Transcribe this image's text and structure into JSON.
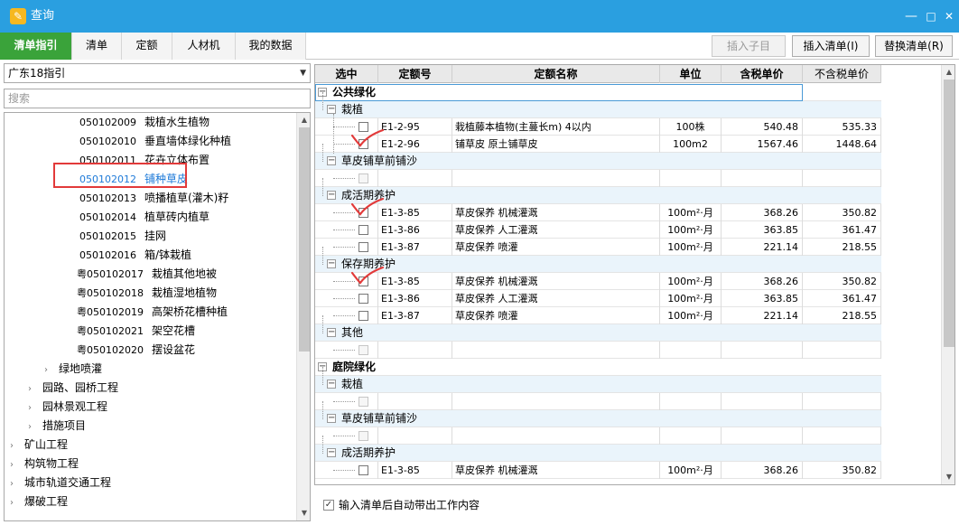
{
  "window": {
    "title": "查询",
    "minimize": "—",
    "maximize": "□",
    "close": "✕"
  },
  "tabs": [
    {
      "label": "清单指引",
      "active": true
    },
    {
      "label": "清单",
      "active": false
    },
    {
      "label": "定额",
      "active": false
    },
    {
      "label": "人材机",
      "active": false
    },
    {
      "label": "我的数据",
      "active": false
    }
  ],
  "toolbar": {
    "insert_child": "插入子目",
    "insert_list": "插入清单(I)",
    "replace_list": "替换清单(R)"
  },
  "left": {
    "combo_value": "广东18指引",
    "search_placeholder": "搜索",
    "tree": [
      {
        "code": "050102009",
        "name": "栽植水生植物"
      },
      {
        "code": "050102010",
        "name": "垂直墙体绿化种植"
      },
      {
        "code": "050102011",
        "name": "花卉立体布置"
      },
      {
        "code": "050102012",
        "name": "铺种草皮",
        "selected": true
      },
      {
        "code": "050102013",
        "name": "喷播植草(灌木)籽"
      },
      {
        "code": "050102014",
        "name": "植草砖内植草"
      },
      {
        "code": "050102015",
        "name": "挂网"
      },
      {
        "code": "050102016",
        "name": "箱/钵栽植"
      },
      {
        "code": "粤050102017",
        "name": "栽植其他地被"
      },
      {
        "code": "粤050102018",
        "name": "栽植湿地植物"
      },
      {
        "code": "粤050102019",
        "name": "高架桥花槽种植"
      },
      {
        "code": "粤050102021",
        "name": "架空花槽"
      },
      {
        "code": "粤050102020",
        "name": "摆设盆花"
      }
    ],
    "folders": [
      {
        "name": "绿地喷灌"
      },
      {
        "name": "园路、园桥工程"
      },
      {
        "name": "园林景观工程"
      },
      {
        "name": "措施项目"
      },
      {
        "name": "矿山工程"
      },
      {
        "name": "构筑物工程"
      },
      {
        "name": "城市轨道交通工程"
      },
      {
        "name": "爆破工程"
      }
    ]
  },
  "grid": {
    "headers": [
      "选中",
      "定额号",
      "定额名称",
      "单位",
      "含税单价",
      "不含税单价"
    ],
    "rows": [
      {
        "kind": "sec",
        "label": "公共绿化"
      },
      {
        "kind": "grp",
        "label": "栽植"
      },
      {
        "kind": "item",
        "code": "E1-2-95",
        "name": "栽植藤本植物(主蔓长m) 4以内",
        "unit": "100株",
        "price_tax": "540.48",
        "price": "535.33"
      },
      {
        "kind": "item",
        "code": "E1-2-96",
        "name": "铺草皮 原土铺草皮",
        "unit": "100m2",
        "price_tax": "1567.46",
        "price": "1448.64",
        "checked": true
      },
      {
        "kind": "grp",
        "label": "草皮铺草前铺沙"
      },
      {
        "kind": "empty"
      },
      {
        "kind": "grp",
        "label": "成活期养护"
      },
      {
        "kind": "item",
        "code": "E1-3-85",
        "name": "草皮保养 机械灌溉",
        "unit": "100m²·月",
        "price_tax": "368.26",
        "price": "350.82",
        "checked": true
      },
      {
        "kind": "item",
        "code": "E1-3-86",
        "name": "草皮保养 人工灌溉",
        "unit": "100m²·月",
        "price_tax": "363.85",
        "price": "361.47"
      },
      {
        "kind": "item",
        "code": "E1-3-87",
        "name": "草皮保养 喷灌",
        "unit": "100m²·月",
        "price_tax": "221.14",
        "price": "218.55"
      },
      {
        "kind": "grp",
        "label": "保存期养护"
      },
      {
        "kind": "item",
        "code": "E1-3-85",
        "name": "草皮保养 机械灌溉",
        "unit": "100m²·月",
        "price_tax": "368.26",
        "price": "350.82",
        "checked": true
      },
      {
        "kind": "item",
        "code": "E1-3-86",
        "name": "草皮保养 人工灌溉",
        "unit": "100m²·月",
        "price_tax": "363.85",
        "price": "361.47"
      },
      {
        "kind": "item",
        "code": "E1-3-87",
        "name": "草皮保养 喷灌",
        "unit": "100m²·月",
        "price_tax": "221.14",
        "price": "218.55"
      },
      {
        "kind": "grp",
        "label": "其他"
      },
      {
        "kind": "empty"
      },
      {
        "kind": "sec",
        "label": "庭院绿化"
      },
      {
        "kind": "grp",
        "label": "栽植"
      },
      {
        "kind": "empty"
      },
      {
        "kind": "grp",
        "label": "草皮铺草前铺沙"
      },
      {
        "kind": "empty"
      },
      {
        "kind": "grp",
        "label": "成活期养护"
      },
      {
        "kind": "item",
        "code": "E1-3-85",
        "name": "草皮保养 机械灌溉",
        "unit": "100m²·月",
        "price_tax": "368.26",
        "price": "350.82"
      }
    ]
  },
  "bottom": {
    "auto_content_label": "输入清单后自动带出工作内容",
    "auto_content_checked": true
  },
  "colors": {
    "title_bar": "#2a9fe0",
    "active_tab": "#3aa33a",
    "selected_text": "#1e7ad8",
    "annotation_red": "#e23a3a",
    "group_row": "#eaf4fb"
  }
}
